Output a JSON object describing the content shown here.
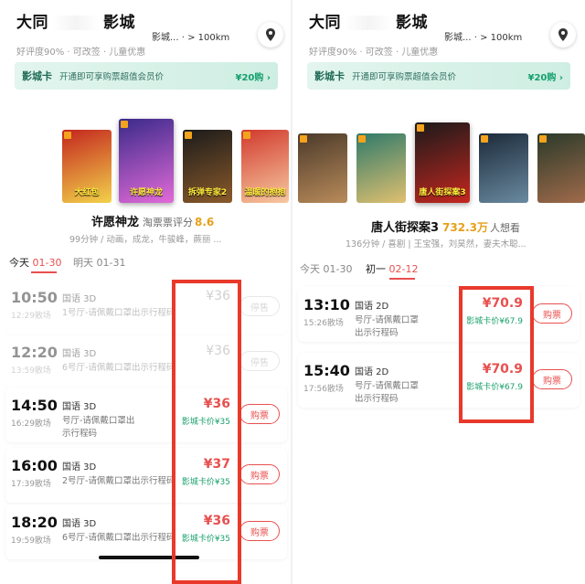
{
  "left": {
    "cinema": {
      "name_prefix": "大同",
      "name_suffix": "影城",
      "address": "影城... · > 100km",
      "meta": "好评度90% · 可改签 · 儿童优惠"
    },
    "vip": {
      "label": "影城卡",
      "desc": "开通即可享购票超值会员价",
      "cta": "¥20购 ›"
    },
    "movie": {
      "title": "许愿神龙",
      "score_label": "淘票票评分",
      "score": "8.6",
      "info": "99分钟 / 动画，成龙，牛骏峰，蕨丽 ..."
    },
    "posters": [
      {
        "title": "大红包",
        "colors": [
          "#c4261f",
          "#f2d24a"
        ]
      },
      {
        "title": "许愿神龙",
        "colors": [
          "#3a2a8a",
          "#e26ad8"
        ]
      },
      {
        "title": "拆弹专家2",
        "colors": [
          "#1b1b1b",
          "#8a5a2a"
        ]
      },
      {
        "title": "温暖的抱抱",
        "colors": [
          "#d23a2e",
          "#f6c9a0"
        ]
      }
    ],
    "tabs": [
      {
        "label": "今天",
        "date": "01-30",
        "active": true
      },
      {
        "label": "明天",
        "date": "01-31",
        "active": false
      }
    ],
    "shows": [
      {
        "time": "10:50",
        "end": "12:29散场",
        "lang": "国语 3D",
        "hall": "1号厅-请佩戴口罩出示行程码",
        "hall2": "",
        "price": "¥36",
        "card": "",
        "btn": "停售",
        "past": true
      },
      {
        "time": "12:20",
        "end": "13:59散场",
        "lang": "国语 3D",
        "hall": "6号厅-请佩戴口罩出示行程码",
        "hall2": "",
        "price": "¥36",
        "card": "",
        "btn": "停售",
        "past": true
      },
      {
        "time": "14:50",
        "end": "16:29散场",
        "lang": "国语 3D",
        "hall": "号厅-请佩戴口罩出",
        "hall2": "示行程码",
        "price": "¥36",
        "card": "影城卡价¥35",
        "btn": "购票",
        "past": false
      },
      {
        "time": "16:00",
        "end": "17:39散场",
        "lang": "国语 3D",
        "hall": "2号厅-请佩戴口罩出示行程码",
        "hall2": "",
        "price": "¥37",
        "card": "影城卡价¥35",
        "btn": "购票",
        "past": false
      },
      {
        "time": "18:20",
        "end": "19:59散场",
        "lang": "国语 3D",
        "hall": "6号厅-请佩戴口罩出示行程码",
        "hall2": "",
        "price": "¥36",
        "card": "影城卡价¥35",
        "btn": "购票",
        "past": false
      }
    ]
  },
  "right": {
    "cinema": {
      "name_prefix": "大同",
      "name_suffix": "影城",
      "address": "影城... · > 100km",
      "meta": "好评度90% · 可改签 · 儿童优惠"
    },
    "vip": {
      "label": "影城卡",
      "desc": "开通即可享购票超值会员价",
      "cta": "¥20购 ›"
    },
    "movie": {
      "title": "唐人街探案3",
      "want": "732.3万",
      "want_label": "人想看",
      "info": "136分钟 / 喜剧 | 王宝强，刘昊然，妻夫木聪..."
    },
    "posters": [
      {
        "title": "",
        "colors": [
          "#4b3a2a",
          "#b98b5a"
        ]
      },
      {
        "title": "",
        "colors": [
          "#2f7a6a",
          "#e0c070"
        ]
      },
      {
        "title": "唐人街探案3",
        "colors": [
          "#1a1a1a",
          "#c4261f"
        ]
      },
      {
        "title": "",
        "colors": [
          "#1c2a3a",
          "#6a8aa0"
        ]
      },
      {
        "title": "",
        "colors": [
          "#2a3a2a",
          "#a06a4a"
        ]
      }
    ],
    "tabs": [
      {
        "label": "今天",
        "date": "01-30",
        "active": false
      },
      {
        "label": "初一",
        "date": "02-12",
        "active": true
      }
    ],
    "shows": [
      {
        "time": "13:10",
        "end": "15:26散场",
        "lang": "国语 2D",
        "hall": "号厅-请佩戴口罩",
        "hall2": "出示行程码",
        "price": "¥70.9",
        "card": "影城卡价¥67.9",
        "btn": "购票",
        "past": false
      },
      {
        "time": "15:40",
        "end": "17:56散场",
        "lang": "国语 2D",
        "hall": "号厅-请佩戴口罩",
        "hall2": "出示行程码",
        "price": "¥70.9",
        "card": "影城卡价¥67.9",
        "btn": "购票",
        "past": false
      }
    ]
  }
}
